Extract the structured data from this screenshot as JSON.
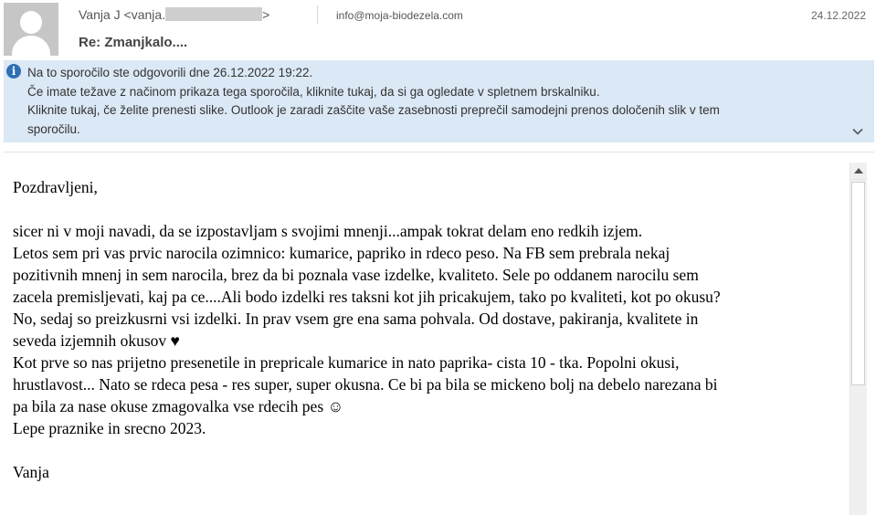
{
  "header": {
    "sender_prefix": "Vanja J <vanja.",
    "sender_suffix": ">",
    "recipient": "info@moja-biodezela.com",
    "date": "24.12.2022",
    "subject": "Re: Zmanjkalo...."
  },
  "infobar": {
    "lines": [
      "Na to sporočilo ste odgovorili dne 26.12.2022 19:22.",
      "Če imate težave z načinom prikaza tega sporočila, kliknite tukaj, da si ga ogledate v spletnem brskalniku.",
      "Kliknite tukaj, če želite prenesti slike. Outlook je zaradi zaščite vaše zasebnosti preprečil samodejni prenos določenih slik v tem",
      "sporočilu."
    ]
  },
  "message": {
    "greeting": "Pozdravljeni,",
    "lines": [
      "sicer ni v moji navadi, da se izpostavljam s svojimi mnenji...ampak tokrat delam eno redkih izjem.",
      "Letos sem pri vas prvic narocila ozimnico: kumarice, papriko in rdeco peso. Na FB sem prebrala nekaj",
      "pozitivnih mnenj in sem narocila, brez da bi poznala vase izdelke, kvaliteto. Sele po oddanem narocilu sem",
      "zacela premisljevati, kaj pa ce....Ali bodo izdelki res taksni kot jih pricakujem, tako po kvaliteti, kot po okusu?",
      "No, sedaj so preizkusrni vsi izdelki. In prav vsem gre ena sama pohvala. Od dostave, pakiranja, kvalitete in",
      "seveda izjemnih okusov ♥",
      "Kot prve so nas prijetno presenetile in prepricale kumarice in nato paprika- cista 10 - tka. Popolni okusi,",
      "hrustlavost... Nato se rdeca pesa - res super, super okusna. Ce bi pa bila se mickeno bolj na debelo narezana bi",
      "pa bila za nase okuse zmagovalka vse rdecih pes ☺",
      "Lepe praznike in srecno 2023."
    ],
    "signature": "Vanja"
  }
}
